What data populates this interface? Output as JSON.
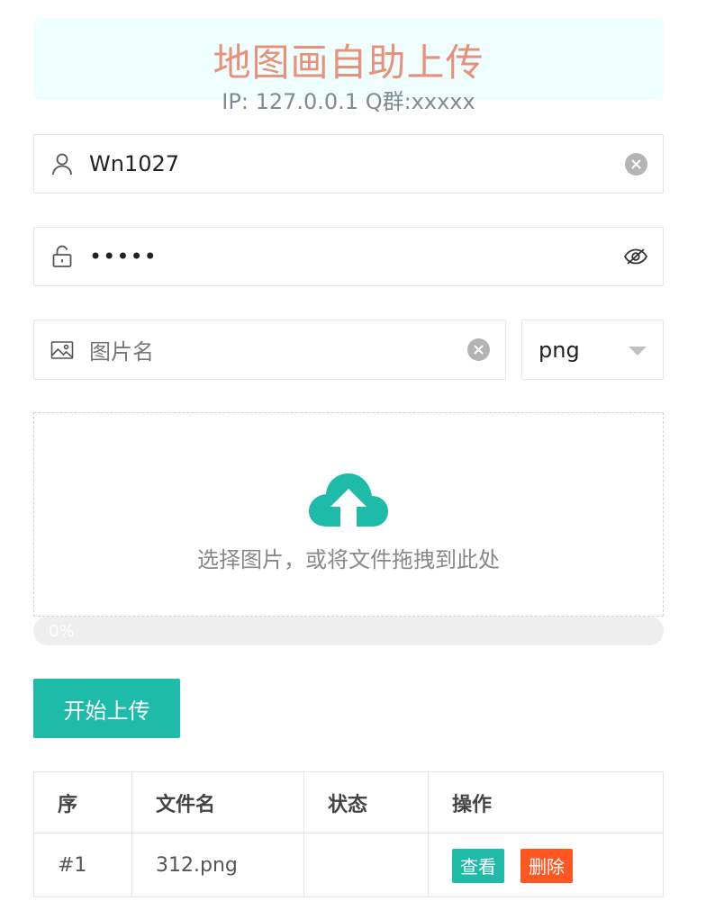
{
  "header": {
    "title": "地图画自助上传",
    "subtitle": "IP: 127.0.0.1  Q群:xxxxx"
  },
  "form": {
    "username": {
      "value": "Wn1027",
      "icon": "user-icon",
      "right_icon": "clear-icon"
    },
    "password": {
      "value": "•••••",
      "icon": "lock-icon",
      "right_icon": "eye-off-icon"
    },
    "image_name": {
      "placeholder": "图片名",
      "icon": "image-icon",
      "right_icon": "clear-icon"
    },
    "format": {
      "selected": "png"
    }
  },
  "dropzone": {
    "icon": "cloud-upload-icon",
    "hint": "选择图片，或将文件拖拽到此处"
  },
  "progress": {
    "percent": 0,
    "label": "0%"
  },
  "upload_button": {
    "label": "开始上传"
  },
  "table": {
    "headers": [
      "序",
      "文件名",
      "状态",
      "操作"
    ],
    "rows": [
      {
        "index": "#1",
        "filename": "312.png",
        "status": "",
        "view_label": "查看",
        "delete_label": "删除"
      }
    ]
  },
  "colors": {
    "accent": "#1ebba8",
    "title": "#e8917a",
    "danger": "#ff5722",
    "header_bg": "#efffff"
  }
}
